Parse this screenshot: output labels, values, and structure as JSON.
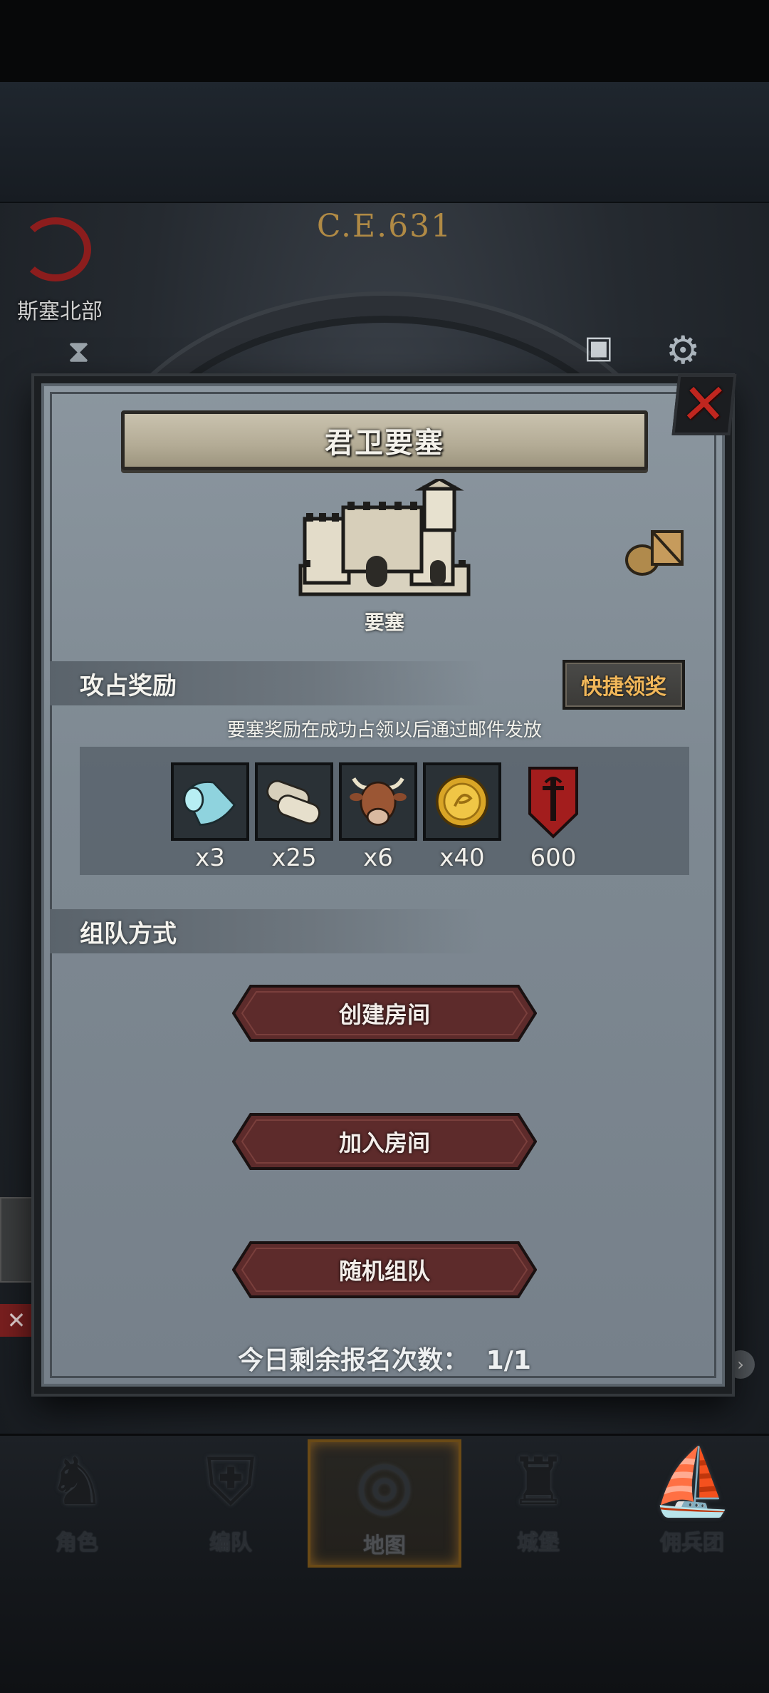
{
  "background": {
    "era": "C.E.631",
    "region_label": "斯塞北部"
  },
  "modal": {
    "title": "君卫要塞",
    "building_caption": "要塞",
    "sections": {
      "reward_title": "攻占奖励",
      "team_title": "组队方式"
    },
    "quick_claim_label": "快捷领奖",
    "reward_note": "要塞奖励在成功占领以后通过邮件发放",
    "rewards": [
      {
        "icon": "cloth-icon",
        "qty": "x3"
      },
      {
        "icon": "scroll-icon",
        "qty": "x25"
      },
      {
        "icon": "cattle-icon",
        "qty": "x6"
      },
      {
        "icon": "gold-coin-icon",
        "qty": "x40"
      },
      {
        "icon": "banner-shield-icon",
        "qty": "600"
      }
    ],
    "buttons": {
      "create": "创建房间",
      "join": "加入房间",
      "random": "随机组队"
    },
    "daily": {
      "label": "今日剩余报名次数：",
      "value": "1/1"
    }
  },
  "bottom_nav": {
    "items": [
      {
        "label": "角色",
        "icon": "knight-icon"
      },
      {
        "label": "编队",
        "icon": "helmet-icon"
      },
      {
        "label": "地图",
        "icon": "compass-map-icon",
        "active": true
      },
      {
        "label": "城堡",
        "icon": "castle-icon"
      },
      {
        "label": "佣兵团",
        "icon": "ship-icon"
      }
    ]
  },
  "colors": {
    "accent_gold": "#f1b75a",
    "close_red": "#c0261f",
    "button_maroon": "#5d2b2b",
    "shield_red": "#a31d1d"
  }
}
